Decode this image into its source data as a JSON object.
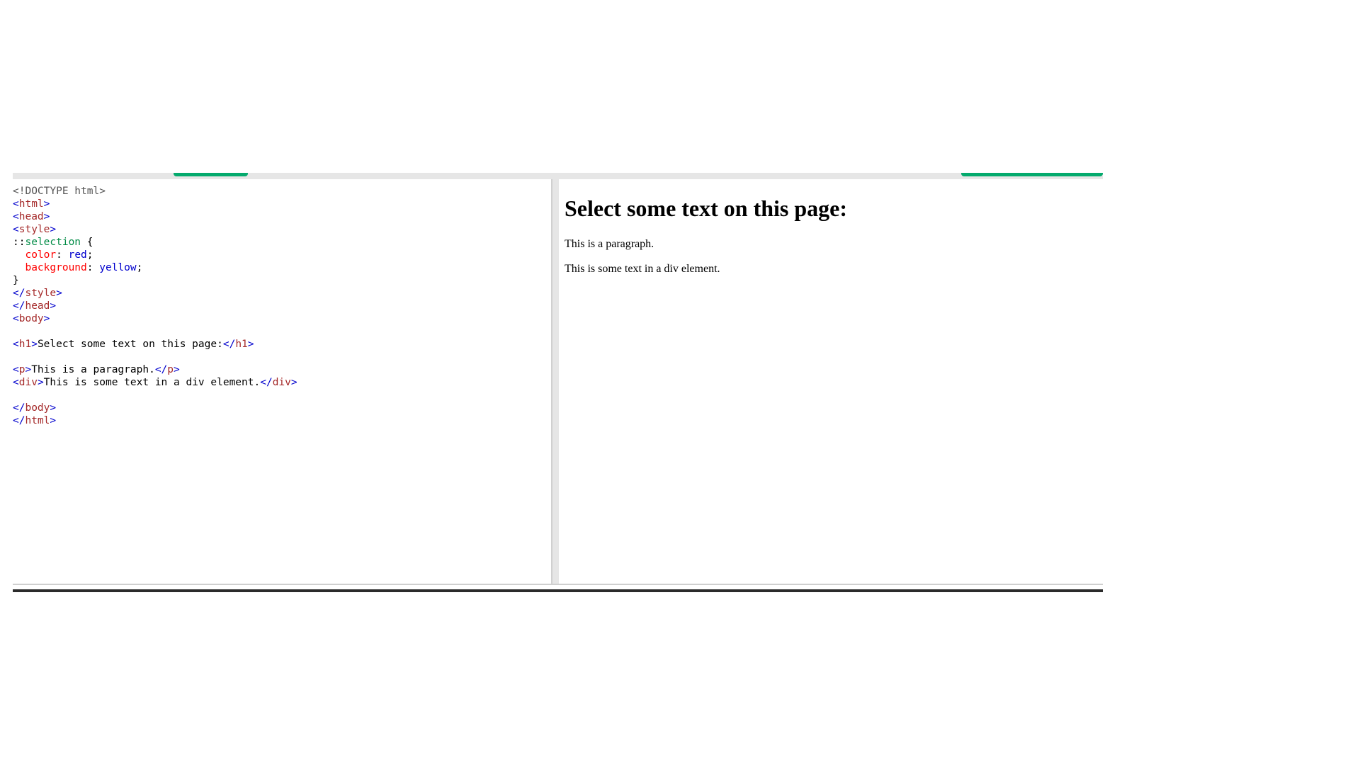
{
  "editor": {
    "lines": [
      [
        {
          "t": "dt",
          "v": "<!DOCTYPE html>"
        }
      ],
      [
        {
          "t": "br",
          "v": "<"
        },
        {
          "t": "tg",
          "v": "html"
        },
        {
          "t": "br",
          "v": ">"
        }
      ],
      [
        {
          "t": "br",
          "v": "<"
        },
        {
          "t": "tg",
          "v": "head"
        },
        {
          "t": "br",
          "v": ">"
        }
      ],
      [
        {
          "t": "br",
          "v": "<"
        },
        {
          "t": "tg",
          "v": "style"
        },
        {
          "t": "br",
          "v": ">"
        }
      ],
      [
        {
          "t": "tx",
          "v": "::"
        },
        {
          "t": "sel",
          "v": "selection"
        },
        {
          "t": "tx",
          "v": " {"
        }
      ],
      [
        {
          "t": "tx",
          "v": "  "
        },
        {
          "t": "prop",
          "v": "color"
        },
        {
          "t": "tx",
          "v": ": "
        },
        {
          "t": "val",
          "v": "red"
        },
        {
          "t": "tx",
          "v": ";"
        }
      ],
      [
        {
          "t": "tx",
          "v": "  "
        },
        {
          "t": "prop",
          "v": "background"
        },
        {
          "t": "tx",
          "v": ": "
        },
        {
          "t": "val",
          "v": "yellow"
        },
        {
          "t": "tx",
          "v": ";"
        }
      ],
      [
        {
          "t": "tx",
          "v": "}"
        }
      ],
      [
        {
          "t": "br",
          "v": "</"
        },
        {
          "t": "tg",
          "v": "style"
        },
        {
          "t": "br",
          "v": ">"
        }
      ],
      [
        {
          "t": "br",
          "v": "</"
        },
        {
          "t": "tg",
          "v": "head"
        },
        {
          "t": "br",
          "v": ">"
        }
      ],
      [
        {
          "t": "br",
          "v": "<"
        },
        {
          "t": "tg",
          "v": "body"
        },
        {
          "t": "br",
          "v": ">"
        }
      ],
      [],
      [
        {
          "t": "br",
          "v": "<"
        },
        {
          "t": "tg",
          "v": "h1"
        },
        {
          "t": "br",
          "v": ">"
        },
        {
          "t": "tx",
          "v": "Select some text on this page:"
        },
        {
          "t": "br",
          "v": "</"
        },
        {
          "t": "tg",
          "v": "h1"
        },
        {
          "t": "br",
          "v": ">"
        }
      ],
      [],
      [
        {
          "t": "br",
          "v": "<"
        },
        {
          "t": "tg",
          "v": "p"
        },
        {
          "t": "br",
          "v": ">"
        },
        {
          "t": "tx",
          "v": "This is a paragraph."
        },
        {
          "t": "br",
          "v": "</"
        },
        {
          "t": "tg",
          "v": "p"
        },
        {
          "t": "br",
          "v": ">"
        }
      ],
      [
        {
          "t": "br",
          "v": "<"
        },
        {
          "t": "tg",
          "v": "div"
        },
        {
          "t": "br",
          "v": ">"
        },
        {
          "t": "tx",
          "v": "This is some text in a div element."
        },
        {
          "t": "br",
          "v": "</"
        },
        {
          "t": "tg",
          "v": "div"
        },
        {
          "t": "br",
          "v": ">"
        }
      ],
      [],
      [
        {
          "t": "br",
          "v": "</"
        },
        {
          "t": "tg",
          "v": "body"
        },
        {
          "t": "br",
          "v": ">"
        }
      ],
      [
        {
          "t": "br",
          "v": "</"
        },
        {
          "t": "tg",
          "v": "html"
        },
        {
          "t": "br",
          "v": ">"
        }
      ]
    ]
  },
  "result": {
    "heading": "Select some text on this page:",
    "paragraph": "This is a paragraph.",
    "div_text": "This is some text in a div element."
  },
  "colors": {
    "accent": "#04aa6d",
    "doctype": "#555555",
    "bracket": "#0000cd",
    "tag": "#a52a2a",
    "selector": "#008b45",
    "property": "#ff0000",
    "value": "#0000cd"
  }
}
